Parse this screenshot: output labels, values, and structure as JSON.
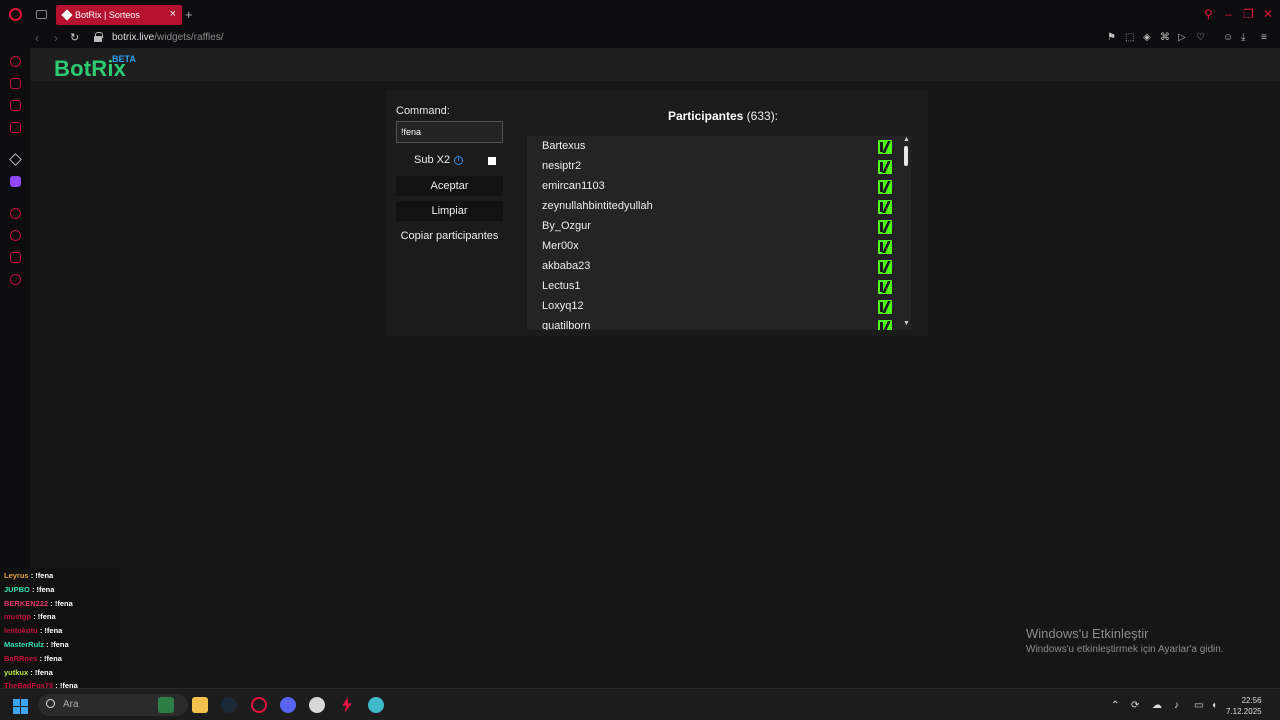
{
  "browser": {
    "tab_title": "BotRix | Sorteos",
    "new_tab": "+",
    "url_host": "botrix.live",
    "url_path": "/widgets/raffles/"
  },
  "site": {
    "brand": "BotRix",
    "beta": "BETA"
  },
  "raffle": {
    "command_label": "Command:",
    "command_value": "!fena",
    "sub_label": "Sub X2",
    "sub_checked": true,
    "accept_label": "Aceptar",
    "clear_label": "Limpiar",
    "copy_label": "Copiar participantes",
    "participants_title": "Participantes",
    "participants_count": "(633):",
    "participants": [
      "Bartexus",
      "nesiptr2",
      "emircan1103",
      "zeynullahbintitedyullah",
      "By_Ozgur",
      "Mer00x",
      "akbaba23",
      "Lectus1",
      "Loxyq12",
      "quatilborn"
    ],
    "platform_icon": "kick-icon",
    "platform_color": "#53fc18"
  },
  "windows_activation": {
    "title": "Windows'u Etkinleştir",
    "subtitle": "Windows'u etkinleştirmek için Ayarlar'a gidin."
  },
  "chat": [
    {
      "user": "Leyrus",
      "msg": ": !fena",
      "color": "#e5a13c"
    },
    {
      "user": "JUPBO",
      "msg": ": !fena",
      "color": "#37e0b3"
    },
    {
      "user": "BERKEN222",
      "msg": ": !fena",
      "color": "#e03a6b"
    },
    {
      "user": "mustgp",
      "msg": ": !fena",
      "color": "#c2133f"
    },
    {
      "user": "lentokotu",
      "msg": ": !fena",
      "color": "#c2133f"
    },
    {
      "user": "MasterRulz",
      "msg": ": !fena",
      "color": "#37e0b3"
    },
    {
      "user": "BaRRnes",
      "msg": ": !fena",
      "color": "#c2133f"
    },
    {
      "user": "yutkux",
      "msg": ": !fena",
      "color": "#b8e34a"
    },
    {
      "user": "TheBadFox78",
      "msg": ": !fena",
      "color": "#c2133f"
    }
  ],
  "taskbar": {
    "search_placeholder": "Ara",
    "time": "22:56",
    "date": "7.12.2025",
    "accent": "#3fa4ef"
  }
}
